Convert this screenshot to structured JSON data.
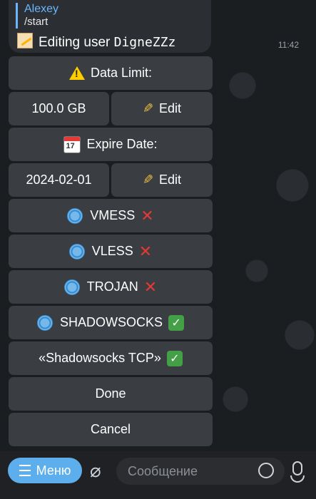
{
  "message": {
    "reply_name": "Alexey",
    "reply_text": "/start",
    "text_prefix": "Editing user ",
    "username": "DigneZZz",
    "time": "11:42"
  },
  "keyboard": {
    "data_limit_label": "Data Limit:",
    "data_limit_value": "100.0 GB",
    "edit_label": "Edit",
    "expire_label": "Expire Date:",
    "expire_value": "2024-02-01",
    "protocols": [
      {
        "name": "VMESS",
        "enabled": false
      },
      {
        "name": "VLESS",
        "enabled": false
      },
      {
        "name": "TROJAN",
        "enabled": false
      },
      {
        "name": "SHADOWSOCKS",
        "enabled": true
      }
    ],
    "inbound_label": "«Shadowsocks TCP»",
    "done_label": "Done",
    "cancel_label": "Cancel"
  },
  "composer": {
    "menu_label": "Меню",
    "placeholder": "Сообщение"
  },
  "colors": {
    "accent": "#5caeed",
    "button_bg": "#3a3e43",
    "disabled_mark": "#e53935",
    "enabled_mark": "#43a047"
  },
  "icons": [
    "warning-icon",
    "pencil-icon",
    "calendar-icon",
    "globe-icon",
    "cross-mark-icon",
    "check-mark-icon",
    "attach-icon",
    "sticker-icon",
    "microphone-icon"
  ]
}
